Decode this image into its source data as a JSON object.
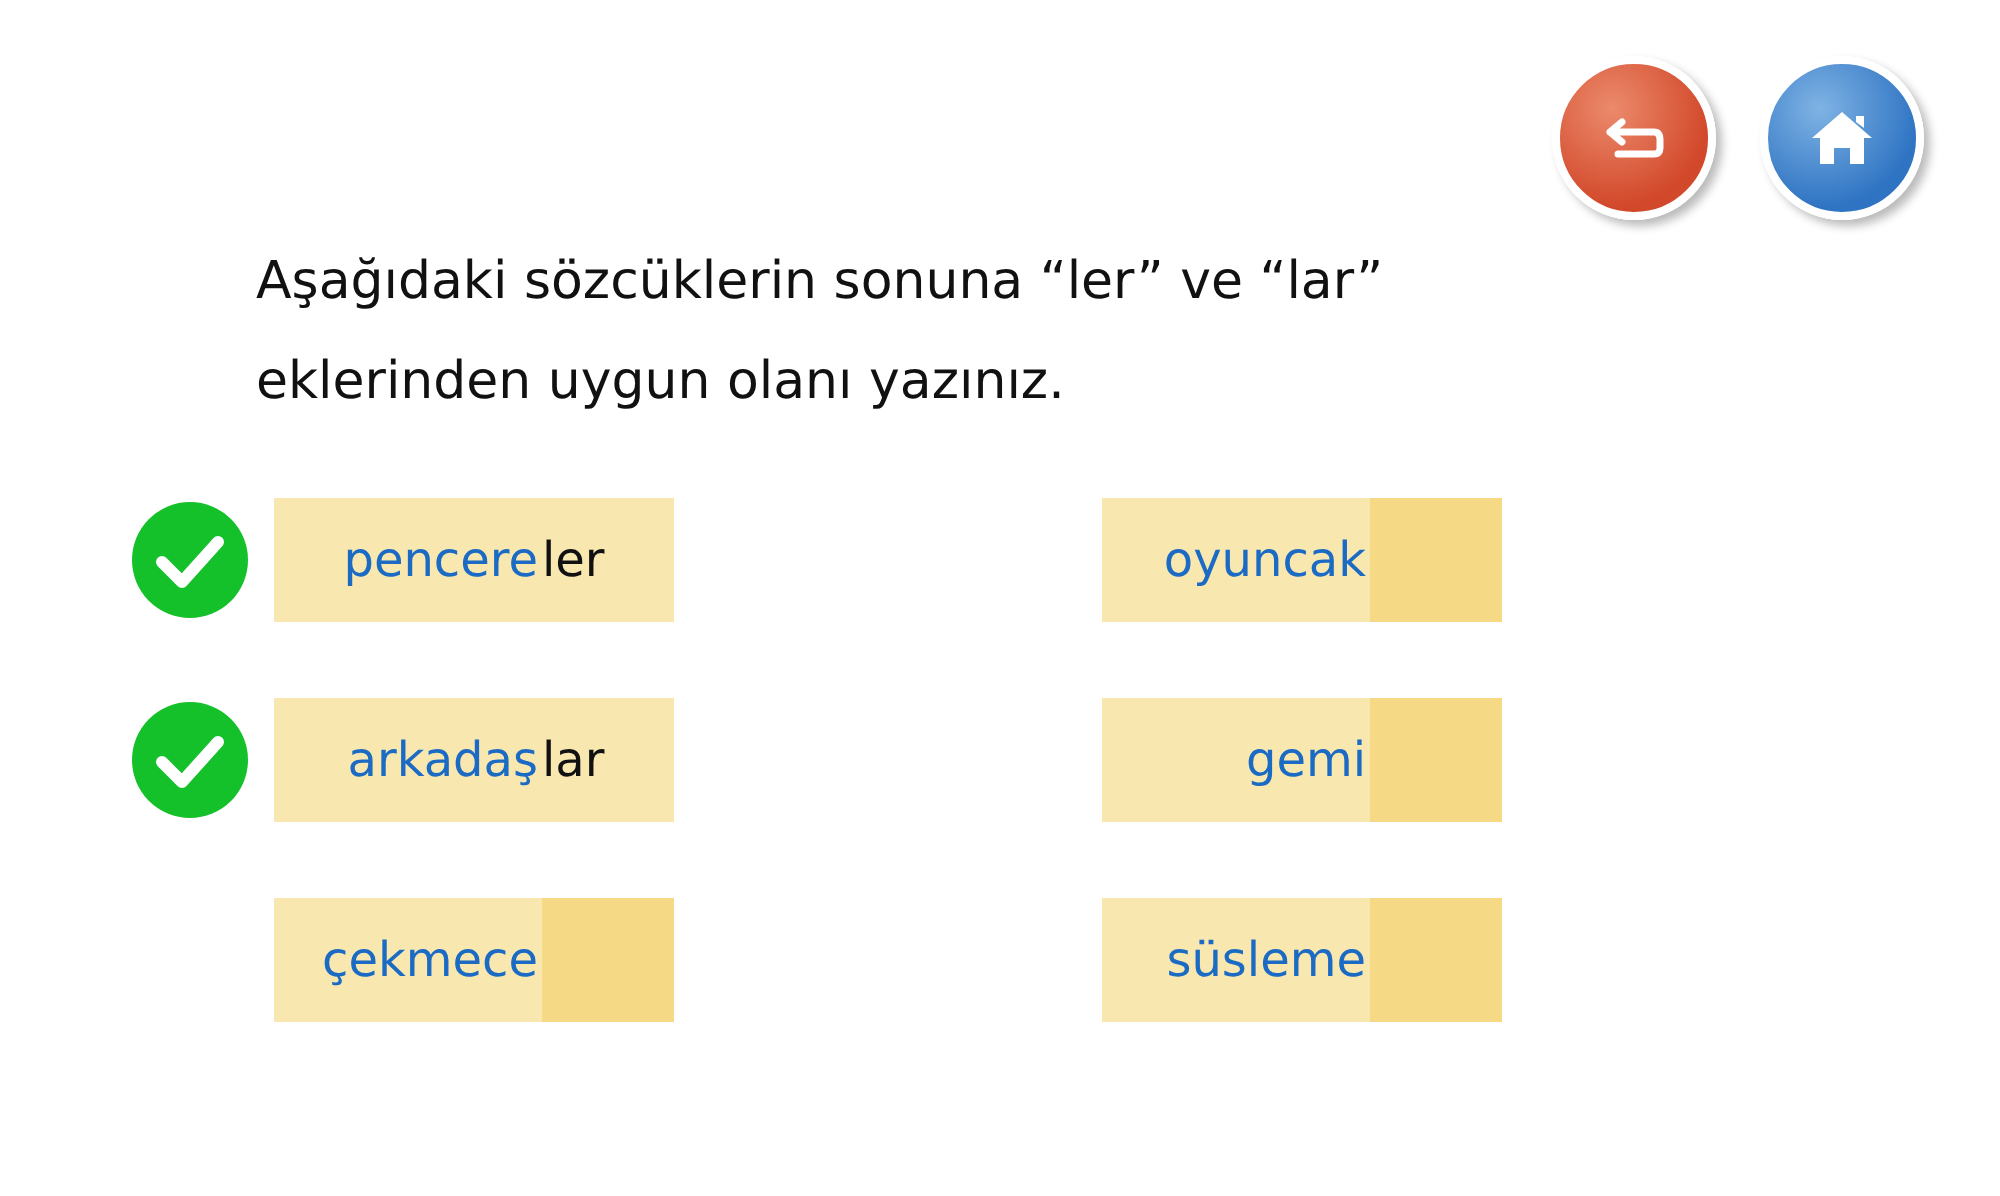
{
  "nav_buttons": [
    {
      "kind": "back"
    },
    {
      "kind": "home"
    }
  ],
  "instruction": "Aşağıdaki sözcüklerin sonuna “ler” ve “lar” eklerinden uygun olanı yazınız.",
  "items": [
    {
      "word": "pencere",
      "answer": "ler",
      "correct": true
    },
    {
      "word": "oyuncak",
      "correct": false
    },
    {
      "word": "arkadaş",
      "answer": "lar",
      "correct": true
    },
    {
      "word": "gemi",
      "correct": false
    },
    {
      "word": "çekmece",
      "correct": false
    },
    {
      "word": "süsleme",
      "correct": false
    }
  ]
}
